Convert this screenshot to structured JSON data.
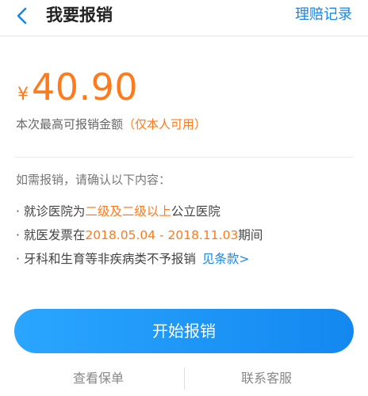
{
  "header": {
    "title": "我要报销",
    "right_link": "理赔记录",
    "back_icon": "chevron-left-icon"
  },
  "amount": {
    "currency": "¥",
    "value": "40.90",
    "caption": "本次最高可报销金额",
    "caption_note": "（仅本人可用）"
  },
  "conditions": {
    "intro": "如需报销，请确认以下内容：",
    "items": [
      {
        "prefix": "· 就诊医院为",
        "highlight": "二级及二级以上",
        "suffix": "公立医院"
      },
      {
        "prefix": "· 就医发票在",
        "highlight": "2018.05.04 - 2018.11.03",
        "suffix": "期间"
      },
      {
        "prefix": "· 牙科和生育等非疾病类不予报销",
        "link": "见条款>"
      }
    ]
  },
  "actions": {
    "primary": "开始报销",
    "left": "查看保单",
    "right": "联系客服"
  },
  "colors": {
    "accent_blue": "#1a86e8",
    "accent_orange": "#ff7a1a"
  }
}
